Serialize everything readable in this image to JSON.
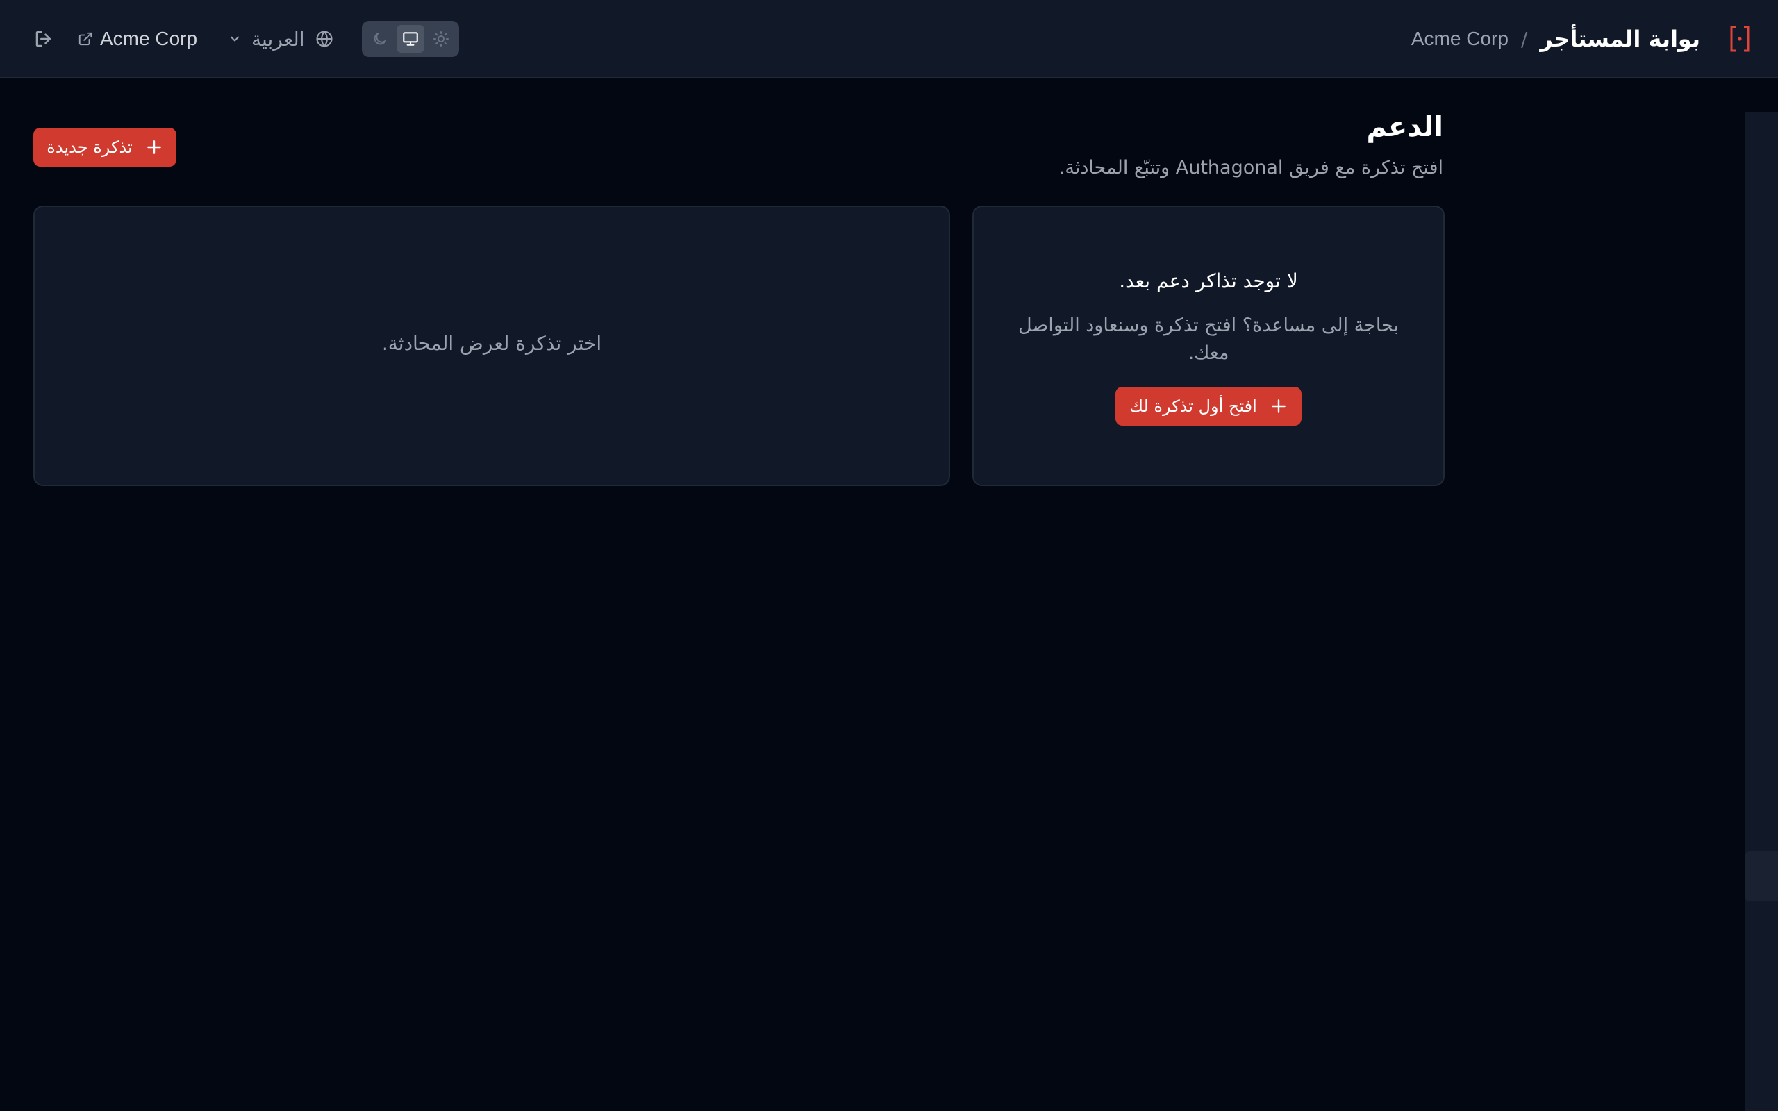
{
  "header": {
    "portal_title": "بوابة المستأجر",
    "breadcrumb_separator": "/",
    "tenant_name": "Acme Corp",
    "tenant_link_label": "Acme Corp",
    "language_label": "العربية",
    "theme_options": [
      "light",
      "system",
      "dark"
    ],
    "theme_selected": "system",
    "accent_color": "#d03a2f"
  },
  "page": {
    "title": "الدعم",
    "subtitle": "افتح تذكرة مع فريق Authagonal وتتبّع المحادثة.",
    "new_ticket_label": "تذكرة جديدة"
  },
  "tickets": {
    "empty_title": "لا توجد تذاكر دعم بعد.",
    "empty_desc": "بحاجة إلى مساعدة؟ افتح تذكرة وسنعاود التواصل معك.",
    "first_ticket_label": "افتح أول تذكرة لك"
  },
  "conversation": {
    "placeholder": "اختر تذكرة لعرض المحادثة."
  }
}
